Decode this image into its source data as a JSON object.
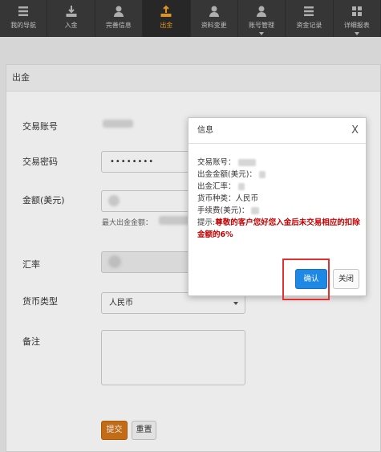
{
  "nav": {
    "items": [
      {
        "label": "我的导航",
        "icon": "grid-menu-icon"
      },
      {
        "label": "入金",
        "icon": "download-tray-icon"
      },
      {
        "label": "完善信息",
        "icon": "user-icon"
      },
      {
        "label": "出金",
        "icon": "upload-tray-icon",
        "active": true
      },
      {
        "label": "资料变更",
        "icon": "user-icon"
      },
      {
        "label": "账号管理",
        "icon": "user-icon",
        "dropdown": true
      },
      {
        "label": "资金记录",
        "icon": "grid-menu-icon"
      },
      {
        "label": "详细报表",
        "icon": "grid-menu-icon",
        "dropdown": true
      }
    ],
    "active_color": "#f0a020"
  },
  "panel": {
    "title": "出金",
    "labels": {
      "account": "交易账号",
      "password": "交易密码",
      "amount": "金额(美元)",
      "rate": "汇率",
      "currency": "货币类型",
      "remark": "备注"
    },
    "password_value": "••••••••",
    "max_hint": "最大出金金额：",
    "currency_value": "人民币",
    "submit_label": "提交",
    "reset_label": "重置",
    "submit_color": "#d4761a"
  },
  "dialog": {
    "title": "信息",
    "close_glyph": "X",
    "lines": {
      "account": "交易账号：",
      "amount": "出金金额(美元)：",
      "rate": "出金汇率：",
      "currency": "货币种类：人民币",
      "fee": "手续费(美元)："
    },
    "warning_prefix": "提示:",
    "warning_text": "尊敬的客户您好您入金后未交易相应的扣除金额的6%",
    "confirm_label": "确认",
    "close_label": "关闭",
    "confirm_color": "#1e88e5",
    "highlight_color": "#e03030"
  }
}
